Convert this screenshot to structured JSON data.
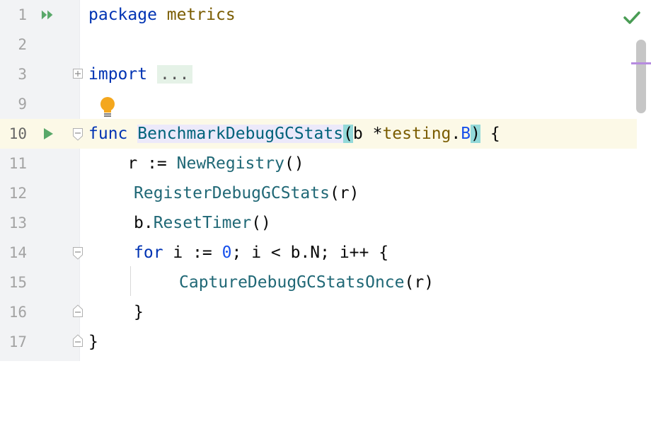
{
  "editor": {
    "lines": [
      {
        "num": "1"
      },
      {
        "num": "2"
      },
      {
        "num": "3"
      },
      {
        "num": "9"
      },
      {
        "num": "10"
      },
      {
        "num": "11"
      },
      {
        "num": "12"
      },
      {
        "num": "13"
      },
      {
        "num": "14"
      },
      {
        "num": "15"
      },
      {
        "num": "16"
      },
      {
        "num": "17"
      }
    ],
    "code": {
      "kw_package": "package",
      "pkg_name": "metrics",
      "kw_import": "import",
      "import_fold": "...",
      "kw_func": "func",
      "func_name": "BenchmarkDebugGCStats",
      "paren_open": "(",
      "param_b": "b *",
      "param_pkg": "testing",
      "dot": ".",
      "param_type": "B",
      "paren_close": ")",
      "open_brace": " {",
      "l11_prefix": "    r := ",
      "l11_call": "NewRegistry",
      "l11_suffix": "()",
      "l12_call": "RegisterDebugGCStats",
      "l12_suffix": "(r)",
      "l13_prefix": "b.",
      "l13_call": "ResetTimer",
      "l13_suffix": "()",
      "kw_for": "for",
      "l14_a": " i := ",
      "l14_num": "0",
      "l14_b": "; i < b.N; i++ {",
      "l15_call": "CaptureDebugGCStatsOnce",
      "l15_suffix": "(r)",
      "l16": "}",
      "l17": "}"
    },
    "icons": {
      "run_all": "double-play-icon",
      "run": "play-icon",
      "intention": "lightbulb-icon",
      "status": "checkmark-icon"
    },
    "colors": {
      "run": "#59a869",
      "bulb": "#f4a71d",
      "check": "#499c54"
    }
  }
}
